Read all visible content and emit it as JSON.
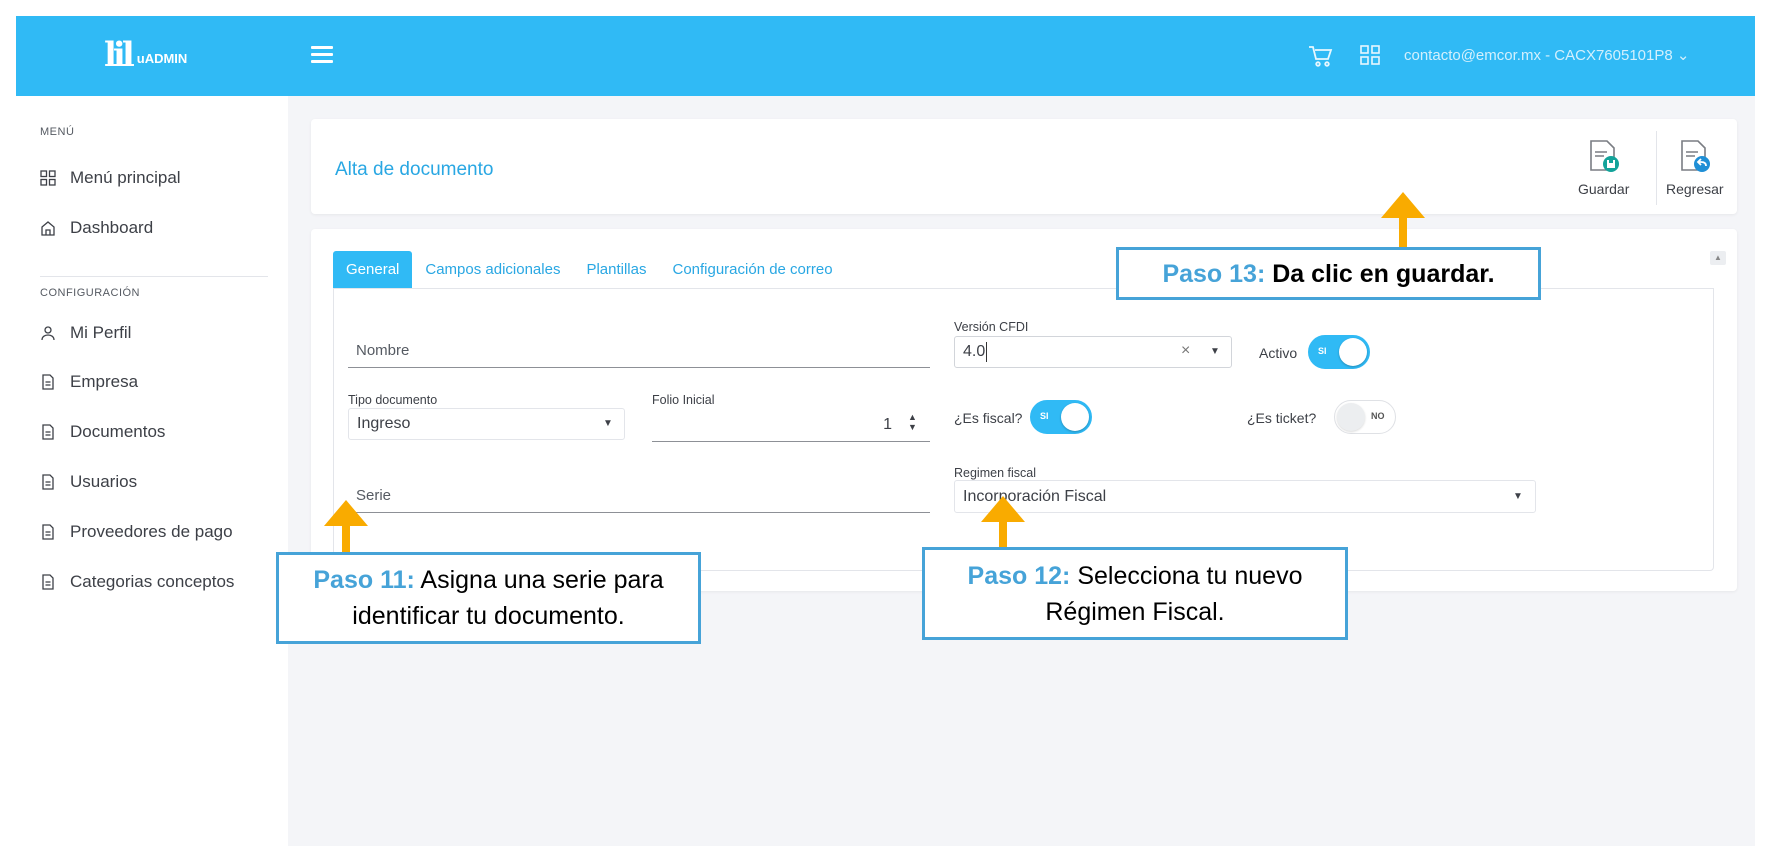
{
  "brand": {
    "name": "uADMIN",
    "mark": "lil"
  },
  "topbar": {
    "user_menu": "contacto@emcor.mx - CACX7605101P8 ⌄"
  },
  "sidebar": {
    "section_menu": "MENÚ",
    "section_config": "CONFIGURACIÓN",
    "items": [
      {
        "label": "Menú principal",
        "icon": "grid-icon"
      },
      {
        "label": "Dashboard",
        "icon": "home-icon"
      },
      {
        "label": "Mi Perfil",
        "icon": "user-icon"
      },
      {
        "label": "Empresa",
        "icon": "document-icon"
      },
      {
        "label": "Documentos",
        "icon": "document-icon"
      },
      {
        "label": "Usuarios",
        "icon": "document-icon"
      },
      {
        "label": "Proveedores de pago",
        "icon": "document-icon"
      },
      {
        "label": "Categorias conceptos",
        "icon": "document-icon"
      }
    ]
  },
  "header": {
    "title": "Alta de documento",
    "save_label": "Guardar",
    "back_label": "Regresar"
  },
  "tabs": [
    "General",
    "Campos adicionales",
    "Plantillas",
    "Configuración de correo"
  ],
  "form": {
    "nombre_placeholder": "Nombre",
    "version_label": "Versión CFDI",
    "version_value": "4.0",
    "version_clear": "×",
    "activo_label": "Activo",
    "activo_state": "SI",
    "tipo_label": "Tipo documento",
    "tipo_value": "Ingreso",
    "folio_label": "Folio Inicial",
    "folio_value": "1",
    "fiscal_label": "¿Es fiscal?",
    "fiscal_state": "SI",
    "ticket_label": "¿Es ticket?",
    "ticket_state": "NO",
    "serie_placeholder": "Serie",
    "regimen_label": "Regimen fiscal",
    "regimen_value": "Incorporación Fiscal"
  },
  "annotations": {
    "step11_tag": "Paso 11:",
    "step11_text_a": "Asigna una serie para",
    "step11_text_b": "identificar tu documento.",
    "step12_tag": "Paso 12:",
    "step12_text_a": "Selecciona tu nuevo",
    "step12_text_b": "Régimen Fiscal.",
    "step13_tag": "Paso 13:",
    "step13_text": "Da clic en guardar."
  },
  "colors": {
    "accent": "#30baf5",
    "link": "#29a7e3",
    "callout_border": "#46a3d8",
    "arrow": "#f9ab00"
  }
}
